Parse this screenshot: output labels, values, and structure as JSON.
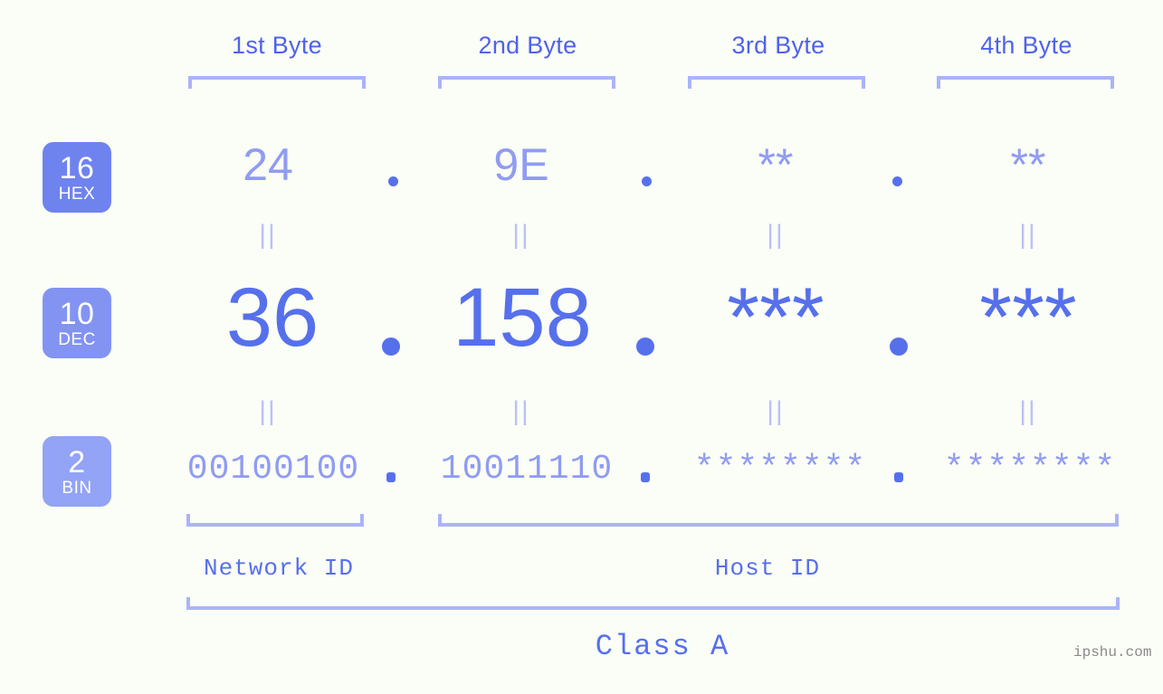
{
  "background": "#fbfdf7",
  "accent": "#5670ec",
  "accent_light": "#8f9cf2",
  "bracket_color": "#aab4f7",
  "columns": [
    {
      "header": "1st Byte"
    },
    {
      "header": "2nd Byte"
    },
    {
      "header": "3rd Byte"
    },
    {
      "header": "4th Byte"
    }
  ],
  "bases": [
    {
      "number": "16",
      "name": "HEX",
      "color": "#6f83ee"
    },
    {
      "number": "10",
      "name": "DEC",
      "color": "#8393f2"
    },
    {
      "number": "2",
      "name": "BIN",
      "color": "#93a3f5"
    }
  ],
  "rows": {
    "hex": {
      "values": [
        "24",
        "9E",
        "**",
        "**"
      ]
    },
    "dec": {
      "values": [
        "36",
        "158",
        "***",
        "***"
      ]
    },
    "bin": {
      "values": [
        "00100100",
        "10011110",
        "********",
        "********"
      ]
    }
  },
  "separator": ".",
  "equals_mark": "||",
  "footer": {
    "network_id": "Network ID",
    "host_id": "Host ID",
    "class_label": "Class A",
    "watermark": "ipshu.com"
  }
}
